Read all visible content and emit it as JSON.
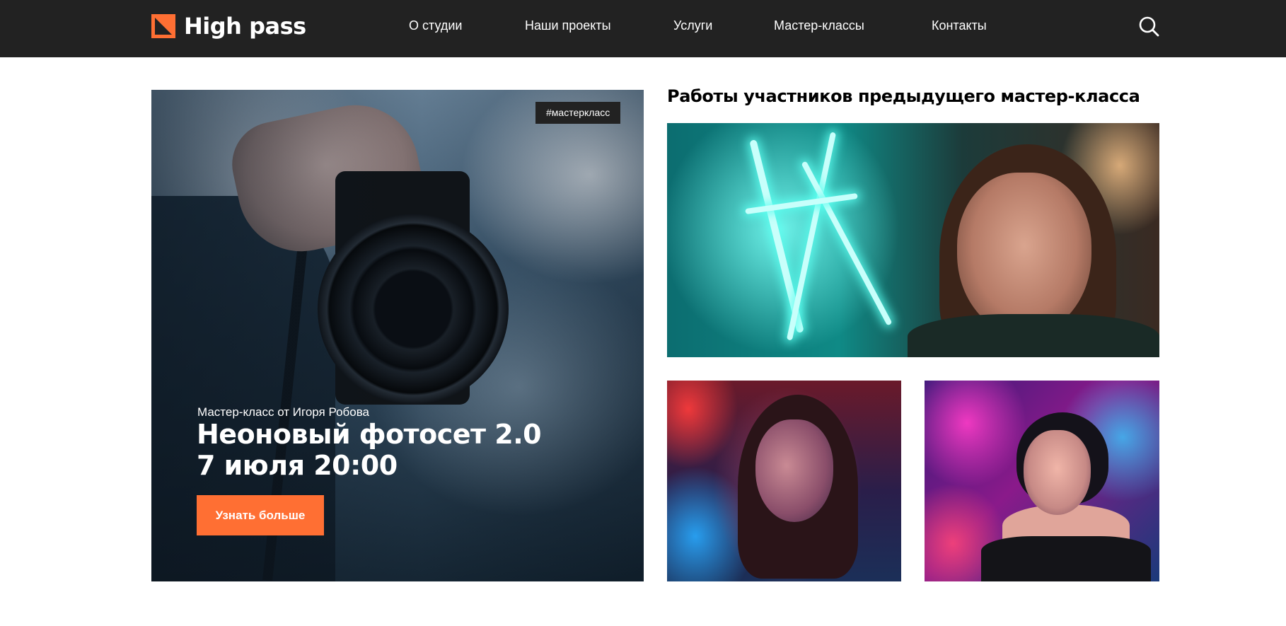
{
  "header": {
    "logo_text": "High pass",
    "nav": [
      "О студии",
      "Наши проекты",
      "Услуги",
      "Мастер-классы",
      "Контакты"
    ],
    "search_icon": "search-icon"
  },
  "hero": {
    "tag": "#мастеркласс",
    "subtitle": "Мастер-класс от Игоря Робова",
    "title_line1": "Неоновый фотосет 2.0",
    "title_line2": "7 июля 20:00",
    "button_label": "Узнать больше"
  },
  "gallery": {
    "title": "Работы участников предыдущего мастер-класса"
  },
  "colors": {
    "header_bg": "#222222",
    "accent": "#ff6f33",
    "text_light": "#ffffff"
  }
}
